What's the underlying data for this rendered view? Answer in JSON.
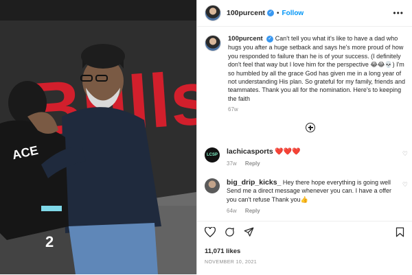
{
  "photo": {
    "banner_text": "Bulls",
    "jersey_text": "ACE",
    "jersey_number": "2"
  },
  "post_header": {
    "username": "100purcent",
    "verified_icon": "verified-badge-icon",
    "separator": "•",
    "follow_label": "Follow",
    "more_icon": "more-horizontal-icon"
  },
  "caption": {
    "username": "100purcent",
    "text": "Can't tell you what it's like to have a dad who hugs you after a huge setback and says he's more proud of how you responded to failure than he is of your success. (I definitely don't feel that way but I love him for the perspective 😂😂💀) I'm so humbled by all the grace God has given me in a long year of not understanding His plan. So grateful for my family, friends and teammates. Thank you all for the nomination. Here's to keeping the faith",
    "time": "67w"
  },
  "load_more_icon": "plus-circle-icon",
  "comments": [
    {
      "username": "lachicasports",
      "avatar_text": "LCSP",
      "text": "❤️❤️❤️",
      "time": "37w",
      "reply_label": "Reply"
    },
    {
      "username": "big_drip_kicks_",
      "text": "Hey there hope everything is going well Send me a direct message whenever you can. I have a offer you can't refuse Thank you👍",
      "time": "64w",
      "reply_label": "Reply"
    }
  ],
  "actions": {
    "icons": [
      "heart-outline-icon",
      "comment-icon",
      "share-icon",
      "bookmark-icon"
    ],
    "likes": "11,071 likes",
    "date": "NOVEMBER 10, 2021"
  },
  "colors": {
    "accent": "#0095f6",
    "banner_red": "#d21f2c",
    "divider": "#dbdbdb"
  }
}
